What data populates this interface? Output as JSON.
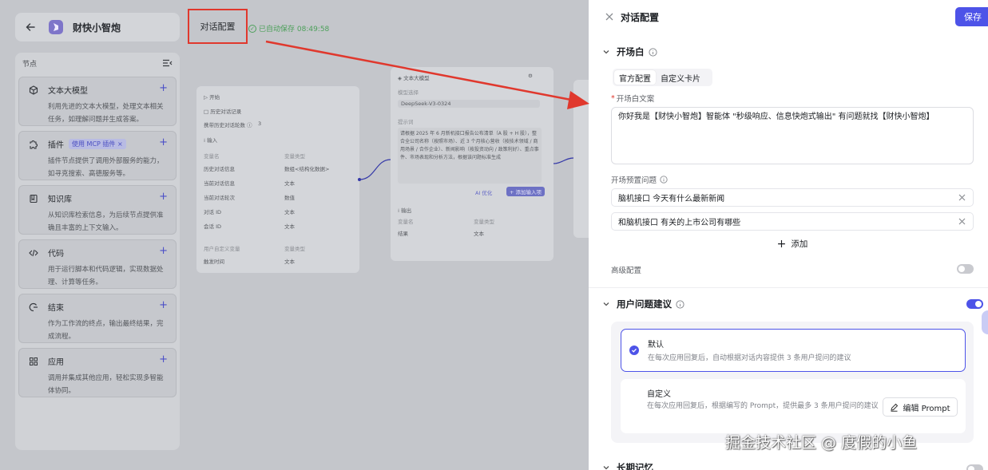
{
  "header": {
    "app_name": "财快小智炮",
    "dialog_tab": "对话配置",
    "autosave": "已自动保存 08:49:58"
  },
  "node_panel": {
    "title": "节点",
    "items": [
      {
        "name": "文本大模型",
        "icon": "cube-icon",
        "desc": "利用先进的文本大模型，处理文本相关任务，如理解问题并生成答案。"
      },
      {
        "name": "插件",
        "icon": "plugin-icon",
        "tag": "使用 MCP 插件 ×",
        "desc": "插件节点提供了调用外部服务的能力，如寻克搜索、高德服务等。"
      },
      {
        "name": "知识库",
        "icon": "book-icon",
        "desc": "从知识库检索信息，为后续节点提供准确且丰富的上下文输入。"
      },
      {
        "name": "代码",
        "icon": "code-icon",
        "desc": "用于运行脚本和代码逻辑，实现数据处理、计算等任务。"
      },
      {
        "name": "结束",
        "icon": "end-icon",
        "desc": "作为工作流的终点，输出最终结果，完成流程。"
      },
      {
        "name": "应用",
        "icon": "apps-icon",
        "desc": "调用并集成其他应用，轻松实现多智能体协同。"
      }
    ]
  },
  "canvas": {
    "start_node": {
      "title": "开始",
      "history": "历史对话记录",
      "rounds_label": "携带历史对话轮数",
      "rounds_value": "3",
      "input_label": "输入",
      "var_header": "变量名",
      "type_header": "变量类型",
      "vars": [
        {
          "name": "历史对话信息",
          "type": "数组<结构化数据>"
        },
        {
          "name": "当前对话信息",
          "type": "文本"
        },
        {
          "name": "当前对话轮次",
          "type": "数值"
        },
        {
          "name": "对话 ID",
          "type": "文本"
        },
        {
          "name": "会话 ID",
          "type": "文本"
        }
      ],
      "custom_header": "用户自定义变量",
      "custom_var": {
        "name": "触发时间",
        "type": "文本"
      }
    },
    "llm_node": {
      "title": "文本大模型",
      "model_label": "模型选择",
      "model": "DeepSeek-V3-0324",
      "prompt_label": "提示词",
      "prompt": "请根据 2025 年 6 月新机接口报告公布清单（A 股 + H 股），整合全公司名称（按照市场）、近 3 个月核心营收（按技术领域 / 商用场景 / 合作企业）、新闻影响（按投资动向 / 政策利好）、重点事件、市场表现和分析方法，根据该问题标准生成",
      "ai_optimize": "AI 优化",
      "add_input": "+ 添加输入项",
      "output_label": "输出",
      "out_var_header": "变量名",
      "out_type_header": "变量类型",
      "out_var": {
        "name": "结果",
        "type": "文本"
      }
    }
  },
  "drawer": {
    "title": "对话配置",
    "save": "保存",
    "opening": {
      "title": "开场白",
      "tabs": [
        "官方配置",
        "自定义卡片"
      ],
      "label": "开场白文案",
      "text": "你好我是【财快小智炮】智能体 \"秒级响应、信息快炮式输出\" 有问题就找【财快小智炮】",
      "preset_label": "开场预置问题",
      "questions": [
        "脑机接口 今天有什么最新新闻",
        "和脑机接口 有关的上市公司有哪些"
      ],
      "add": "添加",
      "advanced": "高级配置",
      "advanced_on": false
    },
    "suggestion": {
      "title": "用户问题建议",
      "enabled": true,
      "options": [
        {
          "title": "默认",
          "desc": "在每次应用回复后，自动根据对话内容提供 3 条用户提问的建议",
          "selected": true
        },
        {
          "title": "自定义",
          "desc": "在每次应用回复后，根据编写的 Prompt，提供最多 3 条用户提问的建议",
          "selected": false
        }
      ],
      "edit_prompt": "编辑 Prompt"
    },
    "memory": {
      "title": "长期记忆",
      "enabled": false
    }
  },
  "watermark": "掘金技术社区 @ 度假的小鱼",
  "colors": {
    "accent": "#4d53e8",
    "annotation_red": "#e0382d",
    "success": "#4ca05a"
  }
}
